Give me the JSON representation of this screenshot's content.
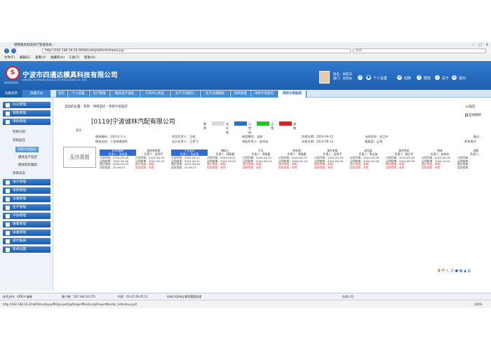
{
  "browser": {
    "tab_title": "德锦模具制造执行管理系统...",
    "address": "http://192.168.16.24:8000/vstl/platform/frame.jsp",
    "search_placeholder": "搜索...",
    "menu": [
      "文件(F)",
      "编辑(E)",
      "查看(V)",
      "收藏夹(A)",
      "工具(T)",
      "帮助(H)"
    ]
  },
  "header": {
    "logo_letter": "S",
    "logo_sub": "SEGMOLDS",
    "company_name": "宁波市四通达模具科技有限公司",
    "company_en": "NINGBO SITONGDA MOULD TECHNOLOGIES CO.,LTD",
    "user_name": "姓名：胡亚军",
    "user_dept": "部门：总经办",
    "links": [
      "个人设置",
      "切换",
      "帮助",
      "关于",
      "退出"
    ]
  },
  "module_bar": {
    "func_menu": "功能菜单",
    "shortcut": "快捷方式",
    "tabs": [
      "首页",
      "个人设置",
      "生产管理",
      "模具生产进度",
      "工作中心状态",
      "生产工时统计",
      "生产日期跟踪",
      "项目管理",
      "项目计划监控",
      "项目计划监控"
    ]
  },
  "sidebar": {
    "groups_top": [
      "办公管理",
      "销售管理",
      "项目管理"
    ],
    "sub_items": [
      "项目计划",
      "项目监控"
    ],
    "sub_sub_items": [
      "项目计划监控",
      "模具生产监控",
      "模具制作跟踪"
    ],
    "sub_extra": "项目日志",
    "groups_bottom": [
      "设计管理",
      "采购管理",
      "仓储管理",
      "生产管理",
      "外协管理",
      "质量管理",
      "设备管理",
      "统计报表",
      "系统设置"
    ]
  },
  "main": {
    "breadcrumb": "当前的位置：项目 - 项目监控 - 项目计划监控",
    "back": "返回",
    "auto_refresh": "自动刷新",
    "project_title": "[0119]宁波诚林汽配有限公司",
    "legend_label": "图例",
    "legend": [
      {
        "label": "未开始",
        "color": "#d9d9d9"
      },
      {
        "label": "已完成",
        "color": "#2b6fd6"
      },
      {
        "label": "正常",
        "color": "#21c821"
      },
      {
        "label": "逾期",
        "color": "#e02020"
      }
    ],
    "reg_label": "签号",
    "info_row1": [
      "模具编码：24012-1-1",
      "项目负责人：王皓",
      "制造属性：自制",
      "交期日期：2024-09-12",
      "当前状态：加工中",
      "备注"
    ],
    "info_row2": [
      "模具名称：1.加啡镜面壳",
      "设计负责人：王梦飞",
      "钳配负责人：赵伟忠",
      "交期日期：2024-09-12",
      "重要度：正常",
      "更多操作"
    ],
    "photo_text": "无仿真图",
    "stages": [
      {
        "title": "BOM清单",
        "sub": "负责人：张永强",
        "blue": true,
        "lines": [
          "计划开始：2024-09-18",
          "计划结束：2024-09-18",
          "预计完成：2024-09-23",
          "实际完成：24.09.23"
        ]
      },
      {
        "title": "监控单采购",
        "sub": "负责人：彭四平",
        "blue": false,
        "lines": [
          "计划开始：2024-09-19",
          "计划结束：2024-09-19",
          "预计完成：未知",
          "实际完成：未完"
        ]
      },
      {
        "title": "工艺设计",
        "sub": "负责人：张永强",
        "blue": true,
        "lines": [
          "计划开始：2024-09-21",
          "计划结束：2024-09-21",
          "预计完成：2024-09-23",
          "实际完成：24.09.23"
        ]
      },
      {
        "title": "模拟工",
        "sub": "负责人：谭高晨",
        "blue": false,
        "lines": [
          "计划开始：2024-09-21",
          "计划结束：2024-09-22",
          "预计完成：未知",
          "实际完成：未完"
        ]
      },
      {
        "title": "打孔",
        "sub": "负责人：谭高晨",
        "blue": false,
        "lines": [
          "计划开始：2024-09-22",
          "计划结束：2024-09-23",
          "预计完成：未知",
          "实际完成：未完"
        ]
      },
      {
        "title": "热处理",
        "sub": "负责人：谭高晨",
        "blue": false,
        "lines": [
          "计划开始：2024-09-23",
          "计划结束：2024-09-23",
          "预计完成：未知",
          "实际完成：未完"
        ]
      },
      {
        "title": "部件采购",
        "sub": "负责人：彭四平",
        "blue": false,
        "lines": [
          "计划开始：2024-09-26",
          "计划结束：2024-09-26",
          "预计完成：未知",
          "实际完成：未完"
        ]
      },
      {
        "title": "成型部",
        "sub": "负责人：奉洁慧",
        "blue": false,
        "lines": [
          "计划开始：2024-09-26",
          "计划结束：2024-09-26",
          "预计完成：未知",
          "实际完成：未完"
        ]
      },
      {
        "title": "部件检验",
        "sub": "负责人：姚文军",
        "blue": false,
        "lines": [
          "计划开始：2024-09-29",
          "计划结束：2024-09-30",
          "预计完成：未知",
          "实际完成：未完"
        ]
      },
      {
        "title": "钳装",
        "sub": "负责人：赵伟忠",
        "blue": false,
        "lines": [
          "计划开始：2024-09-30",
          "计划结束：2024-10-01",
          "预计完成：未知",
          "实际完成：未完"
        ]
      },
      {
        "title": "试模",
        "sub": "负责人：",
        "blue": false,
        "lines": [
          "计划开始：",
          "计划结束：",
          "预计完成：",
          "实际完成："
        ]
      }
    ]
  },
  "status": {
    "tech_support": "技术支持：VIDEA 誉峰",
    "client": "客户端：192.168.16.170",
    "login_time": "时间：03-25 09:45:11",
    "notice": "你有24条待办事项需要处理",
    "url": "http://192.168.16.24:8000/vstl/app/M3/project/pj/ProjectMonitor/pjProjectMonitor_listIndex.jsp#",
    "zone": "在线人员",
    "zoom": "100%"
  }
}
